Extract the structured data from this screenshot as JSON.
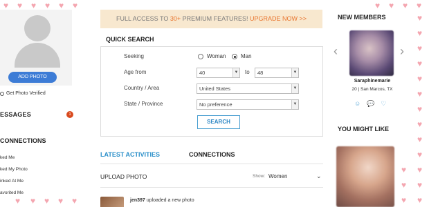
{
  "left": {
    "add_photo_label": "ADD PHOTO",
    "photo_verified_label": "Get Photo Verified",
    "messages_title": "ESSAGES",
    "messages_count": "1",
    "connections_title": "CONNECTIONS",
    "connection_items": [
      "ked Me",
      "ked My Photo",
      "inked At Me",
      "avorited Me"
    ]
  },
  "banner": {
    "prefix": "FULL ACCESS TO ",
    "highlight": "30+",
    "middle": " PREMIUM FEATURES! ",
    "cta": "UPGRADE NOW >>"
  },
  "quick_search": {
    "title": "QUICK SEARCH",
    "seeking_label": "Seeking",
    "option_woman": "Woman",
    "option_man": "Man",
    "selected": "Man",
    "age_from_label": "Age from",
    "age_from": "40",
    "age_to_label": "to",
    "age_to": "48",
    "country_label": "Country / Area",
    "country": "United States",
    "state_label": "State / Province",
    "state": "No preference",
    "search_label": "SEARCH"
  },
  "activity": {
    "tab_latest": "LATEST ACTIVITIES",
    "tab_connections": "CONNECTIONS",
    "section_title": "UPLOAD PHOTO",
    "show_label": "Show:",
    "show_value": "Women",
    "item_user": "jen397",
    "item_text": " uploaded a new photo"
  },
  "right": {
    "new_members_title": "NEW MEMBERS",
    "member_name": "Saraphinemarie",
    "member_location": "20 | San Marcos, TX",
    "you_might_like_title": "YOU MIGHT LIKE"
  },
  "colors": {
    "accent_blue": "#2a8fc9",
    "banner_bg": "#f8e8cf",
    "upgrade_orange": "#e8742d",
    "heart_pink": "#f4a6b0"
  }
}
